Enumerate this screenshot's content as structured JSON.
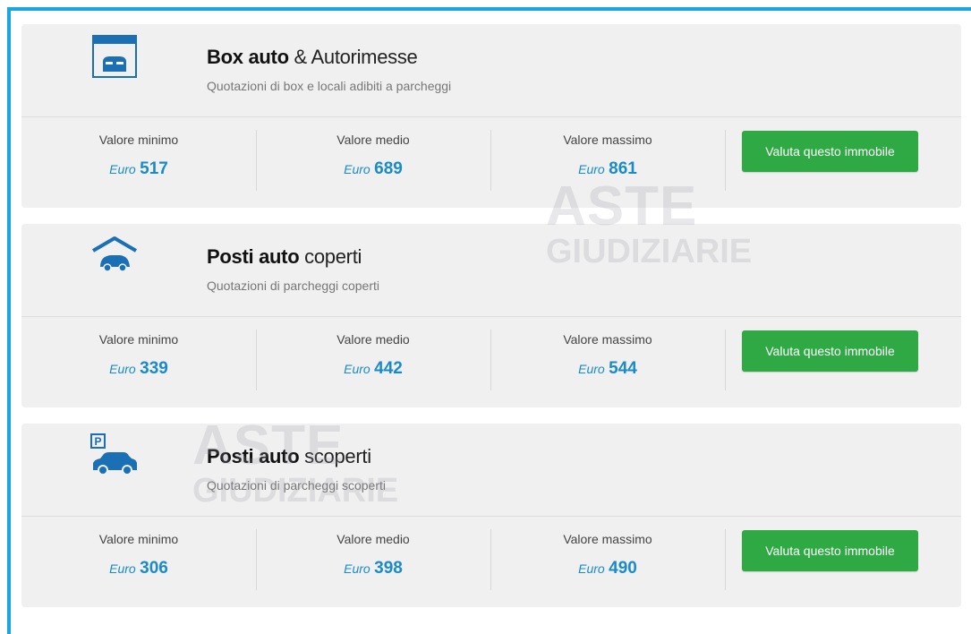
{
  "cards": [
    {
      "icon": "garage-icon",
      "title_bold": "Box auto",
      "title_rest": " & Autorimesse",
      "subtitle": "Quotazioni di box e locali adibiti a parcheggi",
      "min_label": "Valore minimo",
      "mid_label": "Valore medio",
      "max_label": "Valore massimo",
      "currency": "Euro",
      "min_value": "517",
      "mid_value": "689",
      "max_value": "861",
      "button_label": "Valuta questo immobile"
    },
    {
      "icon": "covered-parking-icon",
      "title_bold": "Posti auto",
      "title_rest": " coperti",
      "subtitle": "Quotazioni di parcheggi coperti",
      "min_label": "Valore minimo",
      "mid_label": "Valore medio",
      "max_label": "Valore massimo",
      "currency": "Euro",
      "min_value": "339",
      "mid_value": "442",
      "max_value": "544",
      "button_label": "Valuta questo immobile"
    },
    {
      "icon": "open-parking-icon",
      "title_bold": "Posti auto",
      "title_rest": " scoperti",
      "subtitle": "Quotazioni di parcheggi scoperti",
      "min_label": "Valore minimo",
      "mid_label": "Valore medio",
      "max_label": "Valore massimo",
      "currency": "Euro",
      "min_value": "306",
      "mid_value": "398",
      "max_value": "490",
      "button_label": "Valuta questo immobile"
    }
  ],
  "watermark": {
    "line1": "ASTE",
    "line2": "GIUDIZIARIE"
  },
  "colors": {
    "accent": "#1aa6e0",
    "value": "#1a8bc6",
    "button": "#2ea944",
    "card_bg": "#f0f0f0"
  }
}
